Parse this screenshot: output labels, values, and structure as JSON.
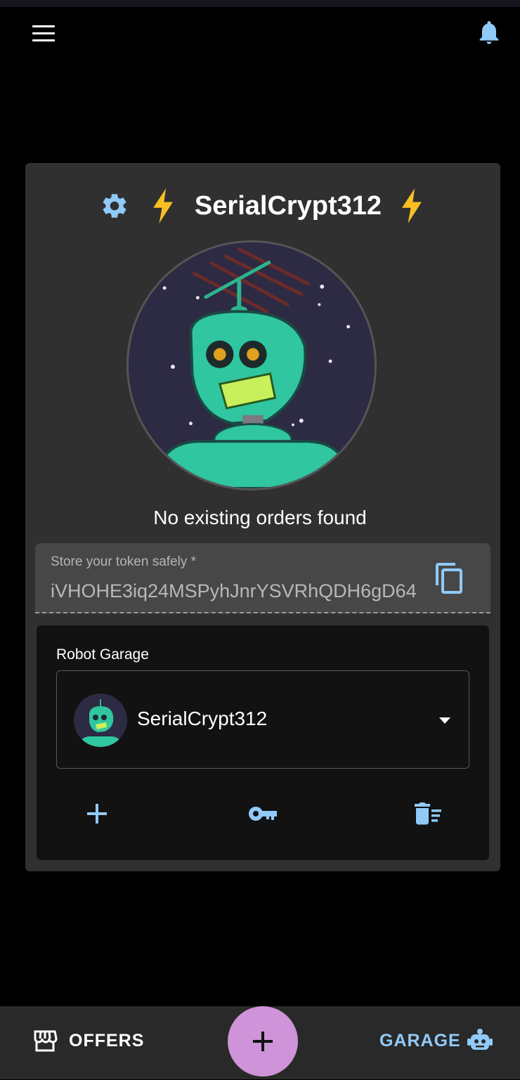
{
  "header": {
    "menu_icon": "hamburger-menu-icon",
    "notifications_icon": "bell-icon"
  },
  "robot": {
    "name": "SerialCrypt312",
    "status": "No existing orders found",
    "settings_icon": "gear-icon",
    "badge_icon": "lightning-bolt-icon"
  },
  "token": {
    "label": "Store your token safely *",
    "value": "iVHOHE3iq24MSPyhJnrYSVRhQDH6gD64",
    "copy_icon": "copy-icon"
  },
  "garage": {
    "label": "Robot Garage",
    "selected_robot": "SerialCrypt312",
    "add_icon": "plus-icon",
    "key_icon": "key-icon",
    "delete_icon": "delete-sweep-icon"
  },
  "bottom_nav": {
    "offers_label": "OFFERS",
    "garage_label": "GARAGE",
    "fab_icon": "plus-icon"
  },
  "colors": {
    "accent_blue": "#90caf9",
    "bolt_yellow": "#fbbf24",
    "fab_pink": "#ce93d8",
    "card_bg": "#303030"
  }
}
